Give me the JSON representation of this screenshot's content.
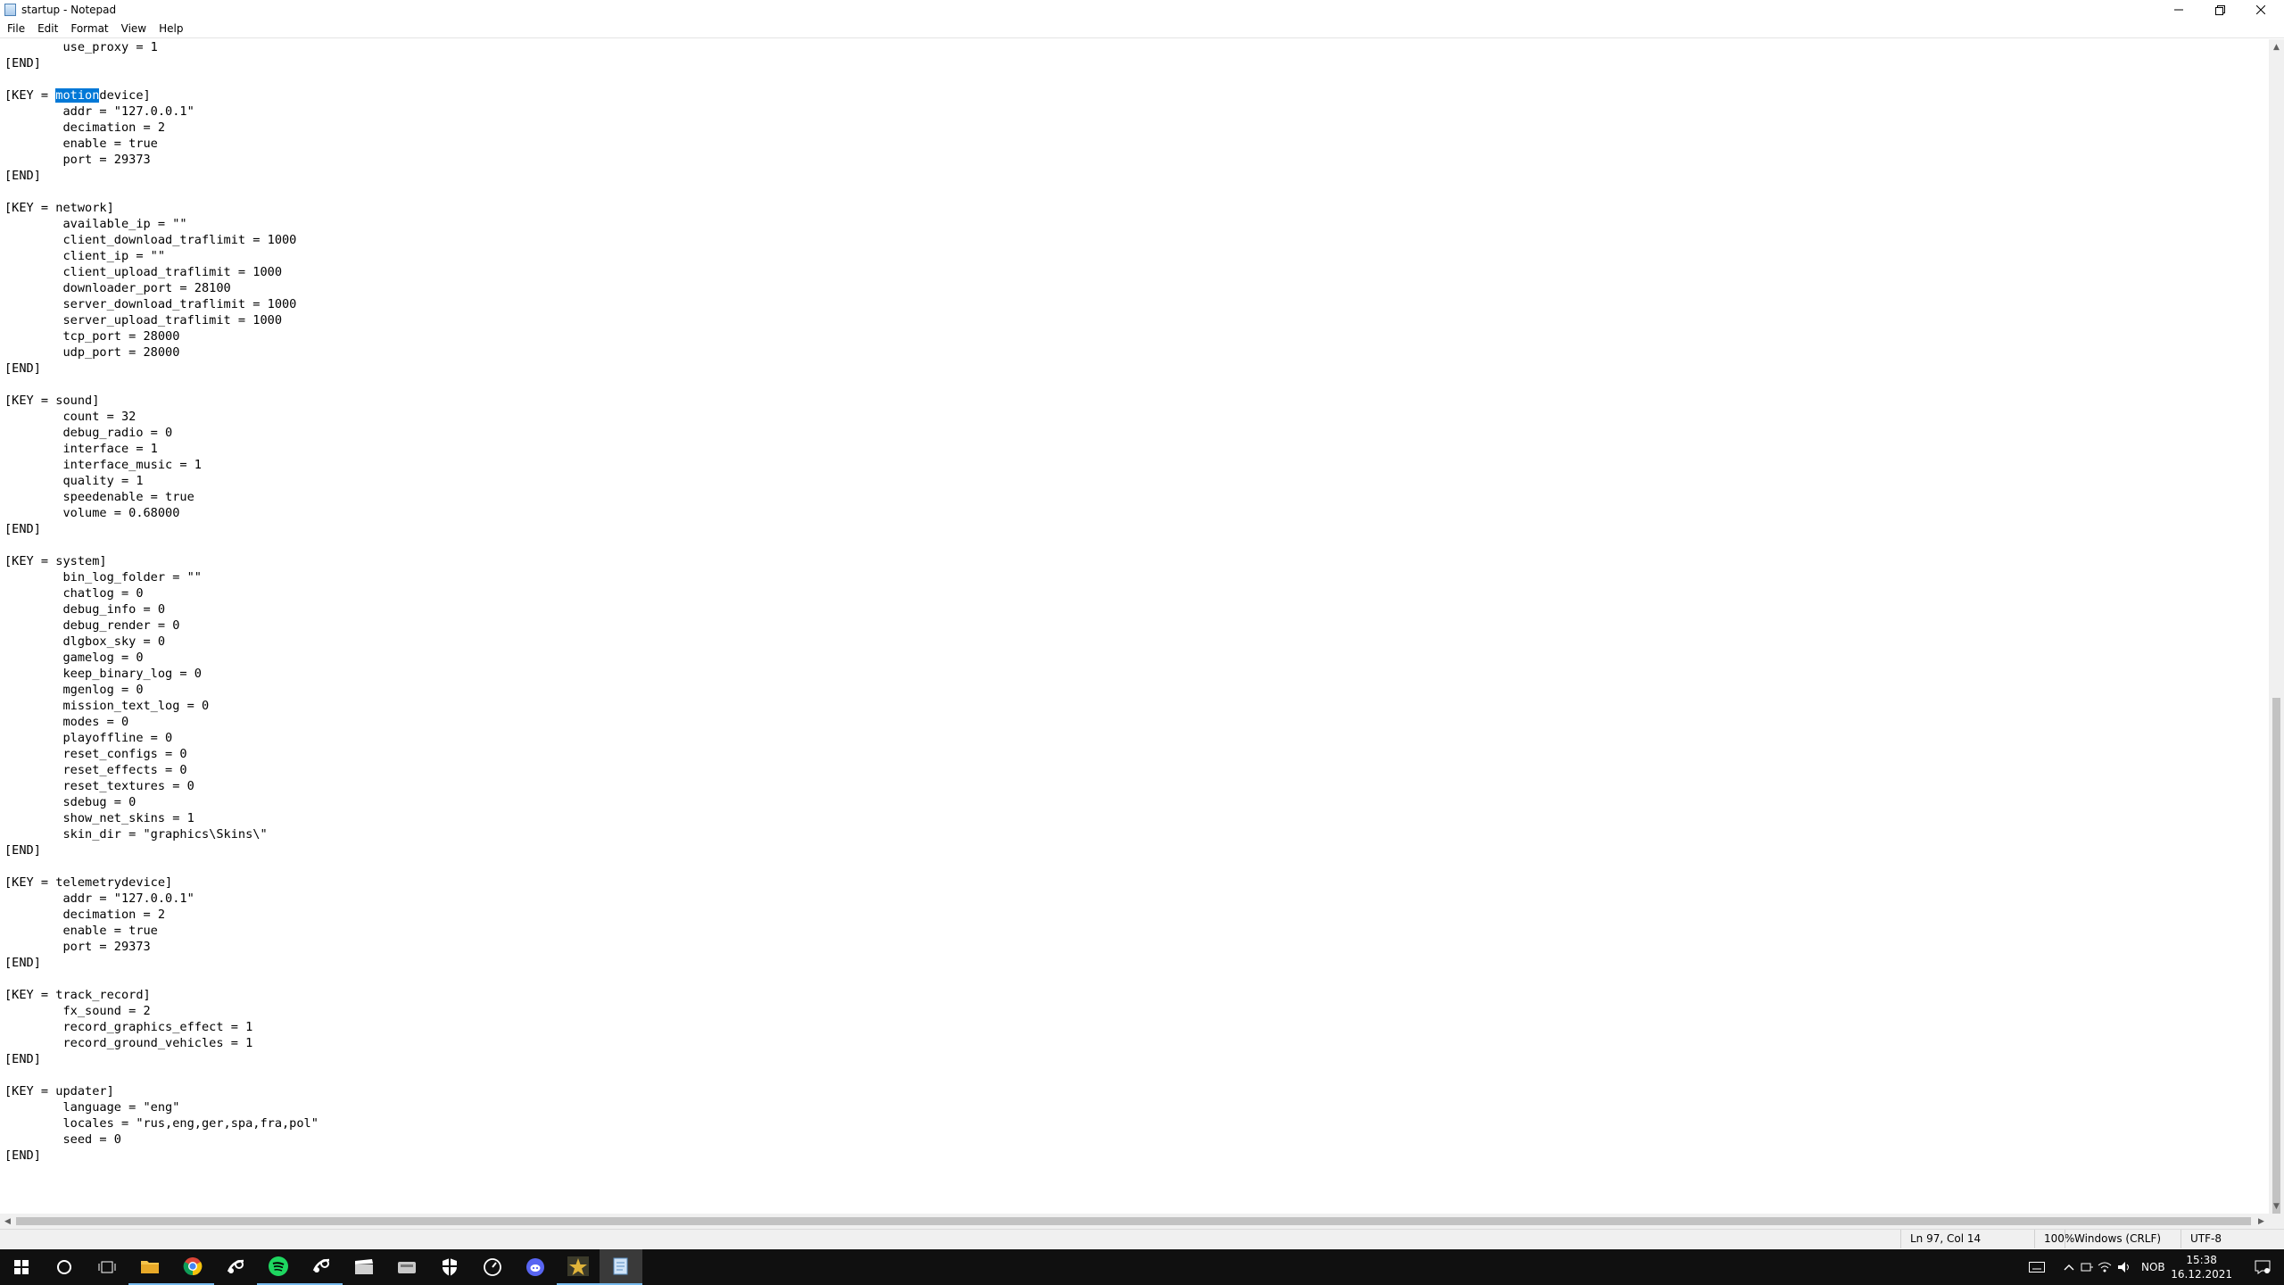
{
  "window": {
    "title": "startup - Notepad",
    "minimize_icon": "minimize-icon",
    "restore_icon": "restore-icon",
    "close_icon": "close-icon"
  },
  "menu": [
    "File",
    "Edit",
    "Format",
    "View",
    "Help"
  ],
  "editor": {
    "lines": [
      "        use_proxy = 1",
      "[END]",
      "",
      "[KEY = motiondevice]",
      "        addr = \"127.0.0.1\"",
      "        decimation = 2",
      "        enable = true",
      "        port = 29373",
      "[END]",
      "",
      "[KEY = network]",
      "        available_ip = \"\"",
      "        client_download_traflimit = 1000",
      "        client_ip = \"\"",
      "        client_upload_traflimit = 1000",
      "        downloader_port = 28100",
      "        server_download_traflimit = 1000",
      "        server_upload_traflimit = 1000",
      "        tcp_port = 28000",
      "        udp_port = 28000",
      "[END]",
      "",
      "[KEY = sound]",
      "        count = 32",
      "        debug_radio = 0",
      "        interface = 1",
      "        interface_music = 1",
      "        quality = 1",
      "        speedenable = true",
      "        volume = 0.68000",
      "[END]",
      "",
      "[KEY = system]",
      "        bin_log_folder = \"\"",
      "        chatlog = 0",
      "        debug_info = 0",
      "        debug_render = 0",
      "        dlgbox_sky = 0",
      "        gamelog = 0",
      "        keep_binary_log = 0",
      "        mgenlog = 0",
      "        mission_text_log = 0",
      "        modes = 0",
      "        playoffline = 0",
      "        reset_configs = 0",
      "        reset_effects = 0",
      "        reset_textures = 0",
      "        sdebug = 0",
      "        show_net_skins = 1",
      "        skin_dir = \"graphics\\Skins\\\"",
      "[END]",
      "",
      "[KEY = telemetrydevice]",
      "        addr = \"127.0.0.1\"",
      "        decimation = 2",
      "        enable = true",
      "        port = 29373",
      "[END]",
      "",
      "[KEY = track_record]",
      "        fx_sound = 2",
      "        record_graphics_effect = 1",
      "        record_ground_vehicles = 1",
      "[END]",
      "",
      "[KEY = updater]",
      "        language = \"eng\"",
      "        locales = \"rus,eng,ger,spa,fra,pol\"",
      "        seed = 0",
      "[END]"
    ],
    "selection": {
      "line": 3,
      "prefix": "[KEY = ",
      "text": "motion",
      "suffix": "device]"
    }
  },
  "statusbar": {
    "position": "Ln 97, Col 14",
    "zoom": "100%",
    "line_ending": "Windows (CRLF)",
    "encoding": "UTF-8"
  },
  "taskbar": {
    "apps": [
      {
        "name": "start-button",
        "icon": "windows-icon",
        "state": "none"
      },
      {
        "name": "search-button",
        "icon": "cortana-circle-icon",
        "state": "none"
      },
      {
        "name": "task-view-button",
        "icon": "task-view-icon",
        "state": "none"
      },
      {
        "name": "file-explorer",
        "icon": "folder-icon",
        "state": "running"
      },
      {
        "name": "chrome",
        "icon": "chrome-icon",
        "state": "running"
      },
      {
        "name": "steam",
        "icon": "steam-icon",
        "state": "none"
      },
      {
        "name": "spotify",
        "icon": "spotify-icon",
        "state": "running"
      },
      {
        "name": "steam-2",
        "icon": "steam-icon",
        "state": "running"
      },
      {
        "name": "app-clapper",
        "icon": "clapper-icon",
        "state": "none"
      },
      {
        "name": "app-drive",
        "icon": "drive-icon",
        "state": "none"
      },
      {
        "name": "app-shield",
        "icon": "shield-icon",
        "state": "none"
      },
      {
        "name": "app-gauge",
        "icon": "gauge-icon",
        "state": "none"
      },
      {
        "name": "app-discord",
        "icon": "discord-icon",
        "state": "none"
      },
      {
        "name": "app-warthunder",
        "icon": "star-game-icon",
        "state": "running"
      },
      {
        "name": "notepad",
        "icon": "notepad-icon",
        "state": "active"
      }
    ],
    "tray": {
      "language": "NOB",
      "time": "15:38",
      "date": "16.12.2021"
    }
  },
  "colors": {
    "selection": "#0078d7",
    "taskbar": "#101010",
    "taskbar_indicator": "#76b9ed"
  }
}
